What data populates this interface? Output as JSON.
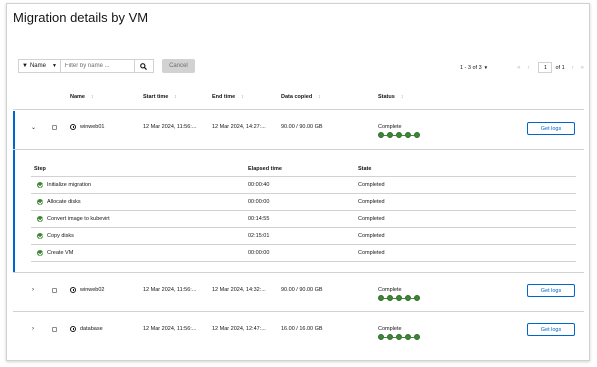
{
  "page": {
    "title": "Migration details by VM"
  },
  "toolbar": {
    "filter_label": "Name",
    "search_placeholder": "Filter by name ...",
    "cancel_label": "Cancel"
  },
  "pagination": {
    "range": "1 - 3 of 3",
    "page": "1",
    "of_pages": "of 1"
  },
  "table": {
    "headers": {
      "name": "Name",
      "start": "Start time",
      "end": "End time",
      "copied": "Data copied",
      "status": "Status"
    },
    "rows": [
      {
        "name": "winweb01",
        "start": "12 Mar 2024, 11:56:...",
        "end": "12 Mar 2024, 14:27:...",
        "copied": "90.00 / 90.00 GB",
        "status": "Complete",
        "action": "Get logs"
      },
      {
        "name": "winweb02",
        "start": "12 Mar 2024, 11:56:...",
        "end": "12 Mar 2024, 14:32:...",
        "copied": "90.00 / 90.00 GB",
        "status": "Complete",
        "action": "Get logs"
      },
      {
        "name": "database",
        "start": "12 Mar 2024, 11:56:...",
        "end": "12 Mar 2024, 12:47:...",
        "copied": "16.00 / 16.00 GB",
        "status": "Complete",
        "action": "Get logs"
      }
    ]
  },
  "steps": {
    "headers": {
      "step": "Step",
      "elapsed": "Elapsed time",
      "state": "State"
    },
    "items": [
      {
        "step": "Initialize migration",
        "elapsed": "00:00:40",
        "state": "Completed"
      },
      {
        "step": "Allocate disks",
        "elapsed": "00:00:00",
        "state": "Completed"
      },
      {
        "step": "Convert image to kubevirt",
        "elapsed": "00:14:55",
        "state": "Completed"
      },
      {
        "step": "Copy disks",
        "elapsed": "02:15:01",
        "state": "Completed"
      },
      {
        "step": "Create VM",
        "elapsed": "00:00:00",
        "state": "Completed"
      }
    ]
  },
  "colors": {
    "success": "#3e8635",
    "link": "#0066cc",
    "border": "#d2d2d2"
  }
}
